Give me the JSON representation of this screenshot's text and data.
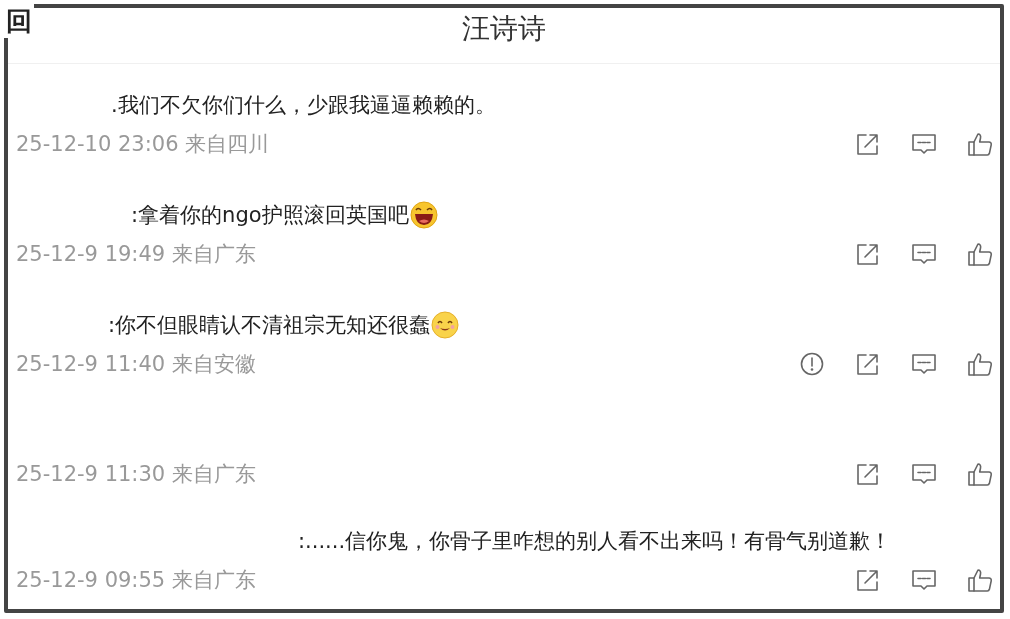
{
  "corner_mark": "回",
  "title": "汪诗诗",
  "comments": [
    {
      "text": ".我们不欠你们什么，少跟我逼逼赖赖的。",
      "meta": "25-12-10 23:06 来自四川",
      "reportable": false
    },
    {
      "text": ":拿着你的ngo护照滚回英国吧",
      "emoji": {
        "kind": "laugh"
      },
      "meta": "25-12-9 19:49 来自广东",
      "reportable": false
    },
    {
      "text": ":你不但眼睛认不清祖宗无知还很蠢",
      "emoji": {
        "kind": "smile"
      },
      "meta": "25-12-9 11:40 来自安徽",
      "reportable": true
    },
    {
      "meta": "25-12-9 11:30 来自广东",
      "reportable": false
    },
    {
      "text": ":......信你鬼，你骨子里咋想的别人看不出来吗！有骨气别道歉！",
      "meta": "25-12-9 09:55 来自广东",
      "reportable": false
    }
  ]
}
